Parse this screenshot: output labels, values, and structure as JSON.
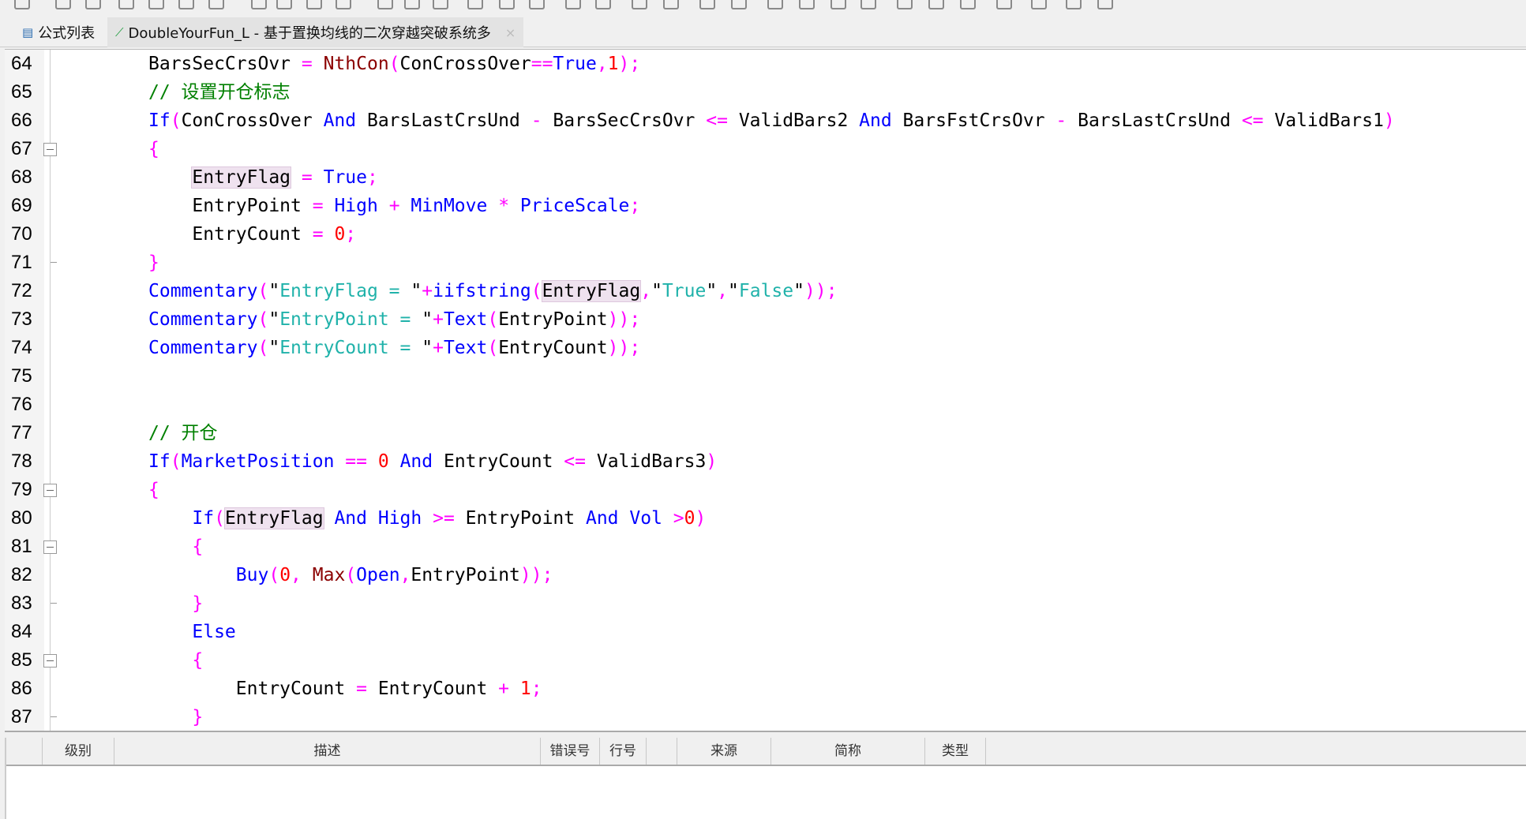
{
  "tabs": [
    {
      "label": "公式列表",
      "icon": "formula-list-icon",
      "active": false
    },
    {
      "label": "DoubleYourFun_L - 基于置换均线的二次穿越突破系统多",
      "icon": "formula-icon",
      "active": true,
      "close": "×"
    }
  ],
  "editor": {
    "lines": [
      {
        "no": "64",
        "tokens": [
          [
            "i",
            "BarsSecCrsOvr "
          ],
          [
            "o",
            "="
          ],
          [
            "i",
            " "
          ],
          [
            "f",
            "NthCon"
          ],
          [
            "o",
            "("
          ],
          [
            "i",
            "ConCrossOver"
          ],
          [
            "o",
            "=="
          ],
          [
            "k",
            "True"
          ],
          [
            "o",
            ","
          ],
          [
            "n",
            "1"
          ],
          [
            "o",
            ");"
          ]
        ]
      },
      {
        "no": "65",
        "tokens": [
          [
            "c",
            "// 设置开仓标志"
          ]
        ]
      },
      {
        "no": "66",
        "tokens": [
          [
            "k",
            "If"
          ],
          [
            "o",
            "("
          ],
          [
            "i",
            "ConCrossOver "
          ],
          [
            "k",
            "And"
          ],
          [
            "i",
            " BarsLastCrsUnd "
          ],
          [
            "o",
            "-"
          ],
          [
            "i",
            " BarsSecCrsOvr "
          ],
          [
            "o",
            "<="
          ],
          [
            "i",
            " ValidBars2 "
          ],
          [
            "k",
            "And"
          ],
          [
            "i",
            " BarsFstCrsOvr "
          ],
          [
            "o",
            "-"
          ],
          [
            "i",
            " BarsLastCrsUnd "
          ],
          [
            "o",
            "<="
          ],
          [
            "i",
            " ValidBars1"
          ],
          [
            "o",
            ")"
          ]
        ]
      },
      {
        "no": "67",
        "fold": "open",
        "tokens": [
          [
            "o",
            "{"
          ]
        ]
      },
      {
        "no": "68",
        "tokens": [
          [
            "i",
            "    "
          ],
          [
            "h",
            "EntryFlag"
          ],
          [
            "i",
            " "
          ],
          [
            "o",
            "="
          ],
          [
            "i",
            " "
          ],
          [
            "k",
            "True"
          ],
          [
            "o",
            ";"
          ]
        ]
      },
      {
        "no": "69",
        "tokens": [
          [
            "i",
            "    EntryPoint "
          ],
          [
            "o",
            "="
          ],
          [
            "i",
            " "
          ],
          [
            "k",
            "High"
          ],
          [
            "i",
            " "
          ],
          [
            "o",
            "+"
          ],
          [
            "i",
            " "
          ],
          [
            "k",
            "MinMove"
          ],
          [
            "i",
            " "
          ],
          [
            "o",
            "*"
          ],
          [
            "i",
            " "
          ],
          [
            "k",
            "PriceScale"
          ],
          [
            "o",
            ";"
          ]
        ]
      },
      {
        "no": "70",
        "tokens": [
          [
            "i",
            "    EntryCount "
          ],
          [
            "o",
            "="
          ],
          [
            "i",
            " "
          ],
          [
            "n",
            "0"
          ],
          [
            "o",
            ";"
          ]
        ]
      },
      {
        "no": "71",
        "fold": "end",
        "tokens": [
          [
            "o",
            "}"
          ]
        ]
      },
      {
        "no": "72",
        "tokens": [
          [
            "k",
            "Commentary"
          ],
          [
            "o",
            "("
          ],
          [
            "i",
            "\""
          ],
          [
            "s",
            "EntryFlag = "
          ],
          [
            "i",
            "\""
          ],
          [
            "o",
            "+"
          ],
          [
            "k",
            "iifstring"
          ],
          [
            "o",
            "("
          ],
          [
            "h",
            "EntryFlag"
          ],
          [
            "o",
            ","
          ],
          [
            "i",
            "\""
          ],
          [
            "s",
            "True"
          ],
          [
            "i",
            "\""
          ],
          [
            "o",
            ","
          ],
          [
            "i",
            "\""
          ],
          [
            "s",
            "False"
          ],
          [
            "i",
            "\""
          ],
          [
            "o",
            "));"
          ]
        ]
      },
      {
        "no": "73",
        "tokens": [
          [
            "k",
            "Commentary"
          ],
          [
            "o",
            "("
          ],
          [
            "i",
            "\""
          ],
          [
            "s",
            "EntryPoint = "
          ],
          [
            "i",
            "\""
          ],
          [
            "o",
            "+"
          ],
          [
            "k",
            "Text"
          ],
          [
            "o",
            "("
          ],
          [
            "i",
            "EntryPoint"
          ],
          [
            "o",
            "));"
          ]
        ]
      },
      {
        "no": "74",
        "tokens": [
          [
            "k",
            "Commentary"
          ],
          [
            "o",
            "("
          ],
          [
            "i",
            "\""
          ],
          [
            "s",
            "EntryCount = "
          ],
          [
            "i",
            "\""
          ],
          [
            "o",
            "+"
          ],
          [
            "k",
            "Text"
          ],
          [
            "o",
            "("
          ],
          [
            "i",
            "EntryCount"
          ],
          [
            "o",
            "));"
          ]
        ]
      },
      {
        "no": "75",
        "tokens": []
      },
      {
        "no": "76",
        "tokens": []
      },
      {
        "no": "77",
        "tokens": [
          [
            "c",
            "// 开仓"
          ]
        ]
      },
      {
        "no": "78",
        "tokens": [
          [
            "k",
            "If"
          ],
          [
            "o",
            "("
          ],
          [
            "k",
            "MarketPosition"
          ],
          [
            "i",
            " "
          ],
          [
            "o",
            "=="
          ],
          [
            "i",
            " "
          ],
          [
            "n",
            "0"
          ],
          [
            "i",
            " "
          ],
          [
            "k",
            "And"
          ],
          [
            "i",
            " EntryCount "
          ],
          [
            "o",
            "<="
          ],
          [
            "i",
            " ValidBars3"
          ],
          [
            "o",
            ")"
          ]
        ]
      },
      {
        "no": "79",
        "fold": "open",
        "tokens": [
          [
            "o",
            "{"
          ]
        ]
      },
      {
        "no": "80",
        "tokens": [
          [
            "i",
            "    "
          ],
          [
            "k",
            "If"
          ],
          [
            "o",
            "("
          ],
          [
            "h",
            "EntryFlag"
          ],
          [
            "i",
            " "
          ],
          [
            "k",
            "And"
          ],
          [
            "i",
            " "
          ],
          [
            "k",
            "High"
          ],
          [
            "i",
            " "
          ],
          [
            "o",
            ">="
          ],
          [
            "i",
            " EntryPoint "
          ],
          [
            "k",
            "And"
          ],
          [
            "i",
            " "
          ],
          [
            "k",
            "Vol"
          ],
          [
            "i",
            " "
          ],
          [
            "o",
            ">"
          ],
          [
            "n",
            "0"
          ],
          [
            "o",
            ")"
          ]
        ]
      },
      {
        "no": "81",
        "fold": "open",
        "tokens": [
          [
            "i",
            "    "
          ],
          [
            "o",
            "{"
          ]
        ]
      },
      {
        "no": "82",
        "tokens": [
          [
            "i",
            "        "
          ],
          [
            "k",
            "Buy"
          ],
          [
            "o",
            "("
          ],
          [
            "n",
            "0"
          ],
          [
            "o",
            ","
          ],
          [
            "i",
            " "
          ],
          [
            "f",
            "Max"
          ],
          [
            "o",
            "("
          ],
          [
            "k",
            "Open"
          ],
          [
            "o",
            ","
          ],
          [
            "i",
            "EntryPoint"
          ],
          [
            "o",
            "));"
          ]
        ]
      },
      {
        "no": "83",
        "fold": "end",
        "tokens": [
          [
            "i",
            "    "
          ],
          [
            "o",
            "}"
          ]
        ]
      },
      {
        "no": "84",
        "tokens": [
          [
            "i",
            "    "
          ],
          [
            "k",
            "Else"
          ]
        ]
      },
      {
        "no": "85",
        "fold": "open",
        "tokens": [
          [
            "i",
            "    "
          ],
          [
            "o",
            "{"
          ]
        ]
      },
      {
        "no": "86",
        "tokens": [
          [
            "i",
            "        EntryCount "
          ],
          [
            "o",
            "="
          ],
          [
            "i",
            " EntryCount "
          ],
          [
            "o",
            "+"
          ],
          [
            "i",
            " "
          ],
          [
            "n",
            "1"
          ],
          [
            "o",
            ";"
          ]
        ]
      },
      {
        "no": "87",
        "fold": "end",
        "tokens": [
          [
            "i",
            "    "
          ],
          [
            "o",
            "}"
          ]
        ]
      }
    ]
  },
  "error_panel": {
    "columns": [
      "",
      "级别",
      "描述",
      "错误号",
      "行号",
      "",
      "来源",
      "简称",
      "类型"
    ]
  },
  "colors": {
    "keyword": "#0000ff",
    "operator": "#ff00ff",
    "number": "#ff0000",
    "comment": "#008000",
    "string": "#20b2aa",
    "function": "#8b0000"
  }
}
